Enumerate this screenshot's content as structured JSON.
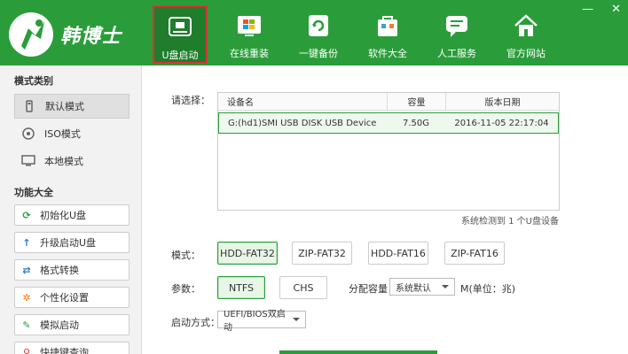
{
  "app": {
    "name": "韩博士"
  },
  "nav": [
    {
      "label": "U盘启动",
      "icon": "usb-drive-icon",
      "active": true
    },
    {
      "label": "在线重装",
      "icon": "windows-icon",
      "active": false
    },
    {
      "label": "一键备份",
      "icon": "backup-refresh-icon",
      "active": false
    },
    {
      "label": "软件大全",
      "icon": "software-bag-icon",
      "active": false
    },
    {
      "label": "人工服务",
      "icon": "chat-service-icon",
      "active": false
    },
    {
      "label": "官方网站",
      "icon": "home-icon",
      "active": false
    }
  ],
  "window": {
    "minimize": "—",
    "close": "✕"
  },
  "sidebar": {
    "modes_title": "模式类别",
    "modes": [
      {
        "label": "默认模式",
        "icon": "usb-icon",
        "active": true
      },
      {
        "label": "ISO模式",
        "icon": "disc-icon",
        "active": false
      },
      {
        "label": "本地模式",
        "icon": "monitor-icon",
        "active": false
      }
    ],
    "functions_title": "功能大全",
    "functions": [
      {
        "label": "初始化U盘",
        "icon": "refresh-icon"
      },
      {
        "label": "升级启动U盘",
        "icon": "upload-arrow-icon"
      },
      {
        "label": "格式转换",
        "icon": "swap-icon"
      },
      {
        "label": "个性化设置",
        "icon": "gear-icon"
      },
      {
        "label": "模拟启动",
        "icon": "pencil-icon"
      },
      {
        "label": "快捷键查询",
        "icon": "search-icon"
      }
    ]
  },
  "main": {
    "select_label": "请选择：",
    "table": {
      "headers": [
        "设备名",
        "容量",
        "版本日期"
      ],
      "rows": [
        {
          "name": "G:(hd1)SMI USB DISK USB Device",
          "capacity": "7.50G",
          "date": "2016-11-05 22:17:04"
        }
      ]
    },
    "status": "系统检测到 1 个U盘设备",
    "mode_label": "模式：",
    "modes": [
      {
        "label": "HDD-FAT32",
        "selected": true
      },
      {
        "label": "ZIP-FAT32",
        "selected": false
      },
      {
        "label": "HDD-FAT16",
        "selected": false
      },
      {
        "label": "ZIP-FAT16",
        "selected": false
      }
    ],
    "param_label": "参数：",
    "params": [
      {
        "label": "NTFS",
        "selected": true
      },
      {
        "label": "CHS",
        "selected": false
      }
    ],
    "alloc_label": "分配容量：",
    "alloc_value": "系统默认",
    "alloc_unit": "M(单位：兆)",
    "boot_label": "启动方式：",
    "boot_value": "UEFI/BIOS双启动"
  },
  "colors": {
    "brand_green": "#2a9d3a",
    "active_border": "#dd3333"
  }
}
